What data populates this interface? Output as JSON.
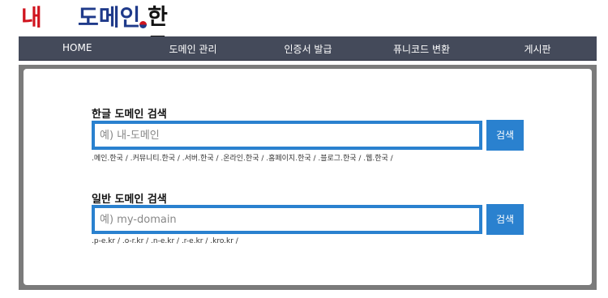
{
  "logo": {
    "text_red": "내",
    "text_blue": "도메인",
    "text_ko": "한국"
  },
  "nav": {
    "items": [
      "HOME",
      "도메인 관리",
      "인증서 발급",
      "퓨니코드 변환",
      "게시판"
    ]
  },
  "korean_search": {
    "title": "한글 도메인 검색",
    "placeholder": "예) 내-도메인",
    "button": "검색",
    "suffixes": ".메인.한국 / .커뮤니티.한국 / .서버.한국 / .온라인.한국 / .홈페이지.한국 / .블로그.한국 / .웹.한국 /"
  },
  "general_search": {
    "title": "일반 도메인 검색",
    "placeholder": "예) my-domain",
    "button": "검색",
    "suffixes": ".p-e.kr / .o-r.kr / .n-e.kr / .r-e.kr / .kro.kr /"
  },
  "colors": {
    "nav_bg": "#444a5a",
    "accent": "#2a81cf",
    "logo_red": "#d0141e",
    "logo_blue": "#1f3a8a"
  }
}
